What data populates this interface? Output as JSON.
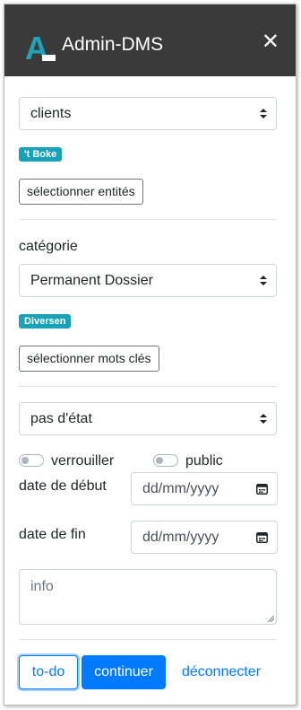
{
  "header": {
    "logo_text": "A",
    "title": "Admin-DMS",
    "close_icon": "close-icon",
    "close_glyph": "✕"
  },
  "filters": {
    "client_select": {
      "value": "clients"
    },
    "entity_badge": "'t Boke",
    "select_entities_label": "sélectionner entités",
    "category_label": "catégorie",
    "category_select": {
      "value": "Permanent Dossier"
    },
    "keyword_badge": "Diversen",
    "select_keywords_label": "sélectionner mots clés",
    "state_select": {
      "value": "pas d'état"
    }
  },
  "toggles": {
    "lock_label": "verrouiller",
    "lock_on": false,
    "public_label": "public",
    "public_on": false
  },
  "dates": {
    "start_label": "date de début",
    "start_placeholder": "dd/mm/yyyy",
    "end_label": "date de fin",
    "end_placeholder": "dd/mm/yyyy"
  },
  "info": {
    "placeholder": "info"
  },
  "actions": {
    "todo_label": "to-do",
    "continue_label": "continuer",
    "disconnect_label": "déconnecter"
  },
  "colors": {
    "header_bg": "#3a3a3a",
    "primary": "#007bff",
    "badge": "#17a2b8",
    "logo": "#20a2b8"
  }
}
